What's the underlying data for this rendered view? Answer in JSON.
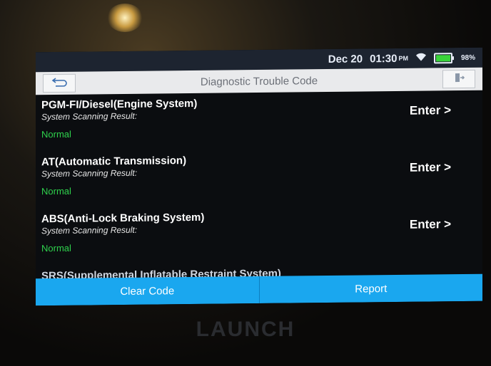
{
  "status": {
    "date": "Dec 20",
    "time": "01:30",
    "ampm": "PM",
    "battery_pct": "98%",
    "battery_level": 0.98
  },
  "header": {
    "title": "Diagnostic Trouble Code"
  },
  "systems": [
    {
      "name": "PGM-FI/Diesel(Engine System)",
      "label": "System Scanning Result:",
      "result": "Normal",
      "action": "Enter >"
    },
    {
      "name": "AT(Automatic Transmission)",
      "label": "System Scanning Result:",
      "result": "Normal",
      "action": "Enter >"
    },
    {
      "name": "ABS(Anti-Lock Braking System)",
      "label": "System Scanning Result:",
      "result": "Normal",
      "action": "Enter >"
    },
    {
      "name": "SRS(Supplemental Inflatable Restraint System)"
    }
  ],
  "footer": {
    "clear_label": "Clear Code",
    "report_label": "Report"
  },
  "device": {
    "brand": "LAUNCH"
  },
  "colors": {
    "accent": "#1aa7ef",
    "ok": "#2fd34d"
  },
  "icons": {
    "back": "back-arrow-icon",
    "exit": "exit-icon",
    "wifi": "wifi-icon",
    "battery": "battery-icon"
  }
}
